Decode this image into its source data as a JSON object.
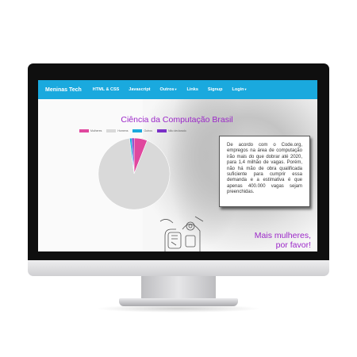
{
  "navbar": {
    "brand": "Meninas Tech",
    "items": [
      {
        "label": "HTML & CSS",
        "dropdown": false
      },
      {
        "label": "Javascript",
        "dropdown": false
      },
      {
        "label": "Outros",
        "dropdown": true
      },
      {
        "label": "Links",
        "dropdown": false
      },
      {
        "label": "Signup",
        "dropdown": false
      },
      {
        "label": "Login",
        "dropdown": true
      }
    ],
    "color": "#1aa9de"
  },
  "heading": "Ciência da Computação Brasil",
  "info_text": "De acordo com o Code.org, empregos na área de computação irão mais do que dobrar até 2020, para 1,4 milhão de vagas. Porém, não há mão de obra qualificada suficiente para cumprir essa demanda e a estimativa é que apenas 400.000 vagas sejam preenchidas.",
  "slogan_line1": "Mais mulheres,",
  "slogan_line2": "por favor!",
  "accent_color": "#9b27c8",
  "chart_data": {
    "type": "pie",
    "series": [
      {
        "name": "Mulheres",
        "value": 6,
        "color": "#e0479e"
      },
      {
        "name": "Homens",
        "value": 92,
        "color": "#d9d9d9"
      },
      {
        "name": "Outros",
        "value": 1,
        "color": "#1aa9de"
      },
      {
        "name": "Não declarado",
        "value": 1,
        "color": "#7a2fc7"
      }
    ],
    "legend": "top"
  }
}
